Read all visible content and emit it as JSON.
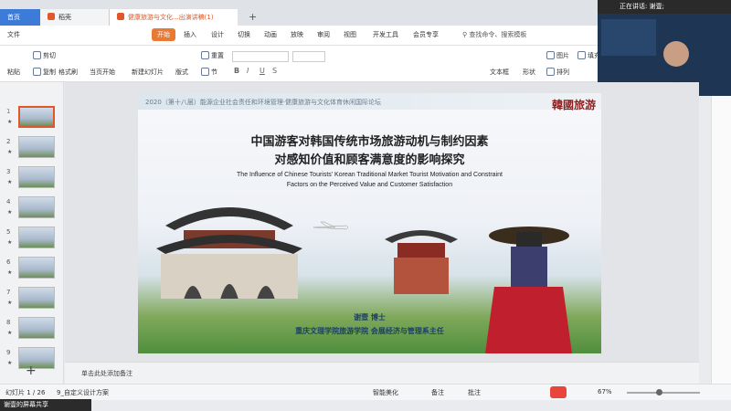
{
  "tabs": {
    "home": "首页",
    "doc": "稻壳",
    "active": "健康旅游与文化...出演讲稿(1)"
  },
  "menu": {
    "file": "文件",
    "start": "开始",
    "insert": "插入",
    "design": "设计",
    "transition": "切换",
    "animation": "动画",
    "slideshow": "放映",
    "review": "审阅",
    "view": "视图",
    "dev": "开发工具",
    "member": "会员专享",
    "search": "查找命令、搜索模板"
  },
  "toolbar": {
    "paste": "粘贴",
    "cut": "剪切",
    "copy": "复制",
    "format_painter": "格式刷",
    "play_from_current": "当页开始",
    "new_slide": "新建幻灯片",
    "layout": "版式",
    "section": "节",
    "reset": "重置",
    "text_box": "文本框",
    "shape": "形状",
    "picture": "图片",
    "fill": "填充",
    "arrange": "排列"
  },
  "video": {
    "speaking": "正在讲话: 谢壹;",
    "name": "谢壹"
  },
  "slide": {
    "header": "2020（第十八届）能源企业社会责任和环境管理·健康旅游与文化体育休闲国际论坛",
    "logo": "韓國旅游",
    "title_line1": "中国游客对韩国传统市场旅游动机与制约因素",
    "title_line2": "对感知价值和顾客满意度的影响探究",
    "subtitle_line1": "The Influence of Chinese Tourists’ Korean Traditional Market Tourist Motivation and Constraint",
    "subtitle_line2": "Factors on the Perceived Value and Customer Satisfaction",
    "author_line1": "谢壹  博士",
    "author_line2": "重庆文理学院旅游学院  会展经济与管理系主任"
  },
  "notes": {
    "placeholder": "单击此处添加备注"
  },
  "status": {
    "slide_counter": "幻灯片 1 / 26",
    "theme": "9_自定义设计方案",
    "smart_beautify": "智能美化",
    "notes_btn": "备注",
    "comments_btn": "批注",
    "zoom": "67%"
  },
  "share": {
    "label": "谢壹的屏幕共享"
  },
  "slides": [
    {
      "num": "1"
    },
    {
      "num": "2"
    },
    {
      "num": "3"
    },
    {
      "num": "4"
    },
    {
      "num": "5"
    },
    {
      "num": "6"
    },
    {
      "num": "7"
    },
    {
      "num": "8"
    },
    {
      "num": "9"
    }
  ],
  "colors": {
    "accent": "#e87a34",
    "home_tab": "#3c7bd8",
    "author_text": "#1d3f6b"
  }
}
